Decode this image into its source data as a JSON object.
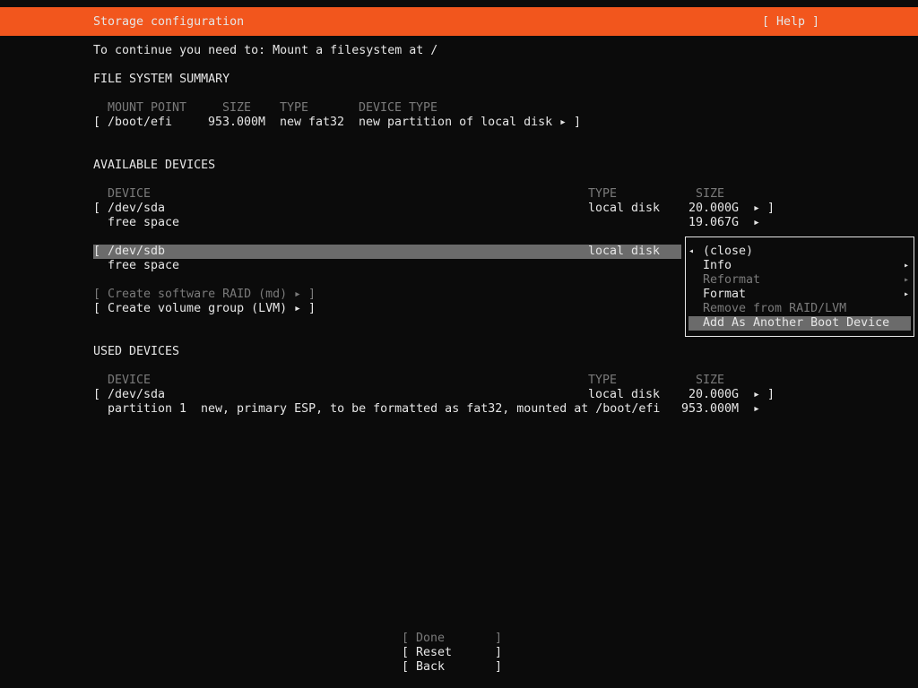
{
  "header": {
    "title": "Storage configuration",
    "help": "[ Help ]"
  },
  "instruction": "To continue you need to: Mount a filesystem at /",
  "fs_summary": {
    "heading": "FILE SYSTEM SUMMARY",
    "columns": [
      "MOUNT POINT",
      "SIZE",
      "TYPE",
      "DEVICE TYPE"
    ],
    "rows": [
      {
        "mount": "/boot/efi",
        "size": "953.000M",
        "type": "new fat32",
        "device_type": "new partition of local disk"
      }
    ]
  },
  "available": {
    "heading": "AVAILABLE DEVICES",
    "columns": [
      "DEVICE",
      "TYPE",
      "SIZE"
    ],
    "devices": [
      {
        "name": "/dev/sda",
        "type": "local disk",
        "size": "20.000G",
        "sub": {
          "name": "free space",
          "size": "19.067G"
        }
      },
      {
        "name": "/dev/sdb",
        "type": "local disk",
        "size": "",
        "sub": {
          "name": "free space",
          "size": ""
        }
      }
    ],
    "raid": "Create software RAID (md)",
    "lvm": "Create volume group (LVM)"
  },
  "used": {
    "heading": "USED DEVICES",
    "columns": [
      "DEVICE",
      "TYPE",
      "SIZE"
    ],
    "devices": [
      {
        "name": "/dev/sda",
        "type": "local disk",
        "size": "20.000G",
        "sub": {
          "name": "partition 1",
          "desc": "new, primary ESP, to be formatted as fat32, mounted at /boot/efi",
          "size": "953.000M"
        }
      }
    ]
  },
  "menu": {
    "items": [
      {
        "label": "(close)",
        "enabled": true
      },
      {
        "label": "Info",
        "enabled": true
      },
      {
        "label": "Reformat",
        "enabled": false
      },
      {
        "label": "Format",
        "enabled": true
      },
      {
        "label": "Remove from RAID/LVM",
        "enabled": false
      },
      {
        "label": "Add As Another Boot Device",
        "enabled": true,
        "selected": true
      }
    ]
  },
  "buttons": {
    "done": "Done",
    "reset": "Reset",
    "back": "Back"
  },
  "glyphs": {
    "right": "▸",
    "left": "◂",
    "open": "[",
    "close": "]"
  },
  "colors": {
    "accent": "#f2561d",
    "background": "#0b0b0b",
    "disabled": "#7a7a7a",
    "selection": "#6b6b6b"
  }
}
